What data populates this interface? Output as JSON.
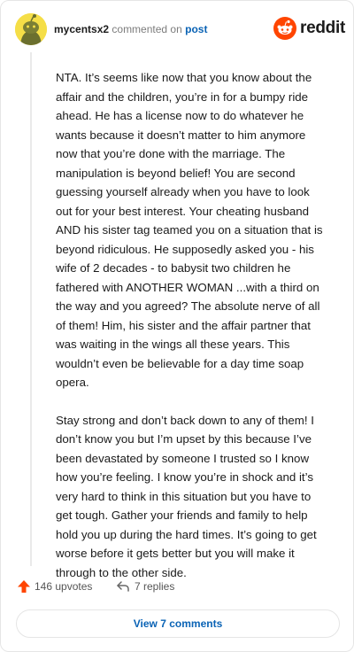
{
  "header": {
    "username": "mycentsx2",
    "commented_text": "commented on",
    "post_link": "post",
    "brand": "reddit"
  },
  "comment": {
    "paragraphs": [
      "NTA. It’s seems like now that you know about the affair and the children, you’re in for a bumpy ride ahead. He has a license now to do whatever he wants because it doesn’t matter to him anymore now that you’re done with the marriage. The manipulation is beyond belief! You are second guessing yourself already when you have to look out for your best interest. Your cheating husband AND his sister tag teamed you on a situation that is beyond ridiculous. He supposedly asked you - his wife of 2 decades - to babysit two children he fathered with ANOTHER WOMAN ...with a third on the way and you agreed? The absolute nerve of all of them! Him, his sister and the affair partner that was waiting in the wings all these years. This wouldn’t even be believable for a day time soap opera.",
      "Stay strong and don’t back down to any of them! I don’t know you but I’m upset by this because I’ve been devastated by someone I trusted so I know how you’re feeling. I know you’re in shock and it’s very hard to think in this situation but you have to get tough. Gather your friends and family to help hold you up during the hard times. It’s going to get worse before it gets better but you will make it through to the other side."
    ]
  },
  "actions": {
    "upvotes": "146 upvotes",
    "replies": "7 replies"
  },
  "footer": {
    "view_comments": "View 7 comments"
  },
  "colors": {
    "accent": "#ff4500",
    "link": "#0a63b5",
    "avatar_bg": "#f5de47"
  },
  "icons": {
    "avatar": "snoo-avatar",
    "brand": "reddit-logo-icon",
    "upvote": "upvote-arrow-icon",
    "reply": "reply-arrow-icon"
  }
}
